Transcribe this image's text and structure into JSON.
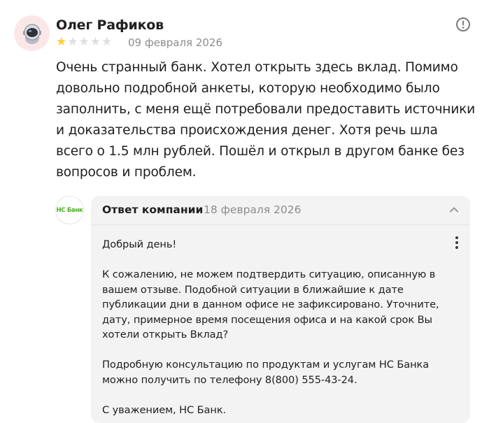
{
  "review": {
    "author": "Олег Рафиков",
    "avatar_icon": "astronaut-avatar",
    "rating": 1,
    "rating_max": 5,
    "date": "09 февраля 2026",
    "text": "Очень странный банк. Хотел открыть здесь вклад. Помимо довольно подробной анкеты, которую необходимо было заполнить, с меня ещё потребовали предоставить источники и доказательства происхождения денег. Хотя речь шла всего о 1.5 млн рублей. Пошёл и открыл в другом банке без вопросов и проблем.",
    "info_icon": "info-icon"
  },
  "reply": {
    "logo_text": "НС Банк",
    "title": "Ответ компании",
    "date": "18 февраля 2026",
    "collapse_icon": "chevron-up-icon",
    "more_icon": "more-vertical-icon",
    "paragraphs": [
      "Добрый день!",
      "К сожалению, не можем подтвердить ситуацию, описанную в вашем отзыве. Подобной ситуации в ближайшие к дате публикации дни в данном офисе не зафиксировано. Уточните, дату, примерное время посещения офиса и на какой срок Вы хотели открыть Вклад?",
      "Подробную консультацию по продуктам и услугам НС Банка можно получить по телефону 8(800) 555-43-24.",
      "С уважением, НС Банк."
    ]
  },
  "colors": {
    "star_filled": "#ffcc33",
    "star_empty": "#dedede",
    "logo_green": "#4caf1e",
    "reply_bg": "#f3f3f3"
  }
}
